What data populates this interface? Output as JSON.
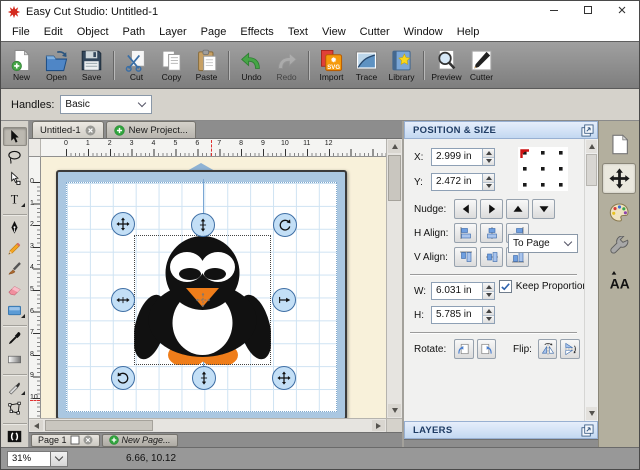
{
  "window": {
    "title": "Easy Cut Studio: Untitled-1",
    "app_icon": "app-logo",
    "controls": {
      "minimize_icon": "window-minimize",
      "maximize_icon": "window-maximize",
      "close_icon": "window-close"
    }
  },
  "menu": {
    "items": [
      "File",
      "Edit",
      "Object",
      "Path",
      "Layer",
      "Page",
      "Effects",
      "Text",
      "View",
      "Cutter",
      "Window",
      "Help"
    ]
  },
  "toolbar": {
    "buttons": [
      {
        "name": "new-button",
        "label": "New",
        "icon": "new-document"
      },
      {
        "name": "open-button",
        "label": "Open",
        "icon": "open-folder"
      },
      {
        "name": "save-button",
        "label": "Save",
        "icon": "save-floppy",
        "sep": true
      },
      {
        "name": "cut-button",
        "label": "Cut",
        "icon": "cut-scissors"
      },
      {
        "name": "copy-button",
        "label": "Copy",
        "icon": "copy-pages"
      },
      {
        "name": "paste-button",
        "label": "Paste",
        "icon": "paste-clipboard",
        "sep": true
      },
      {
        "name": "undo-button",
        "label": "Undo",
        "icon": "undo-arrow"
      },
      {
        "name": "redo-button",
        "label": "Redo",
        "icon": "redo-arrow",
        "disabled": true,
        "sep": true
      },
      {
        "name": "import-button",
        "label": "Import",
        "icon": "import-svg"
      },
      {
        "name": "trace-button",
        "label": "Trace",
        "icon": "trace-image"
      },
      {
        "name": "library-button",
        "label": "Library",
        "icon": "library-book",
        "sep": true
      },
      {
        "name": "preview-button",
        "label": "Preview",
        "icon": "preview-magnifier"
      },
      {
        "name": "cutter-button",
        "label": "Cutter",
        "icon": "cutter-blade"
      }
    ]
  },
  "handles_bar": {
    "label": "Handles:",
    "value": "Basic"
  },
  "document_tabs": {
    "untitled": {
      "label": "Untitled-1",
      "close_icon": "tab-close"
    },
    "new_project": {
      "label": "New Project...",
      "add_icon": "tab-add"
    }
  },
  "left_tools": [
    {
      "name": "select-tool",
      "icon": "select-arrow",
      "active": true
    },
    {
      "name": "lasso-tool",
      "icon": "lasso"
    },
    {
      "name": "node-edit-tool",
      "icon": "node-edit"
    },
    {
      "name": "text-tool",
      "icon": "text-t",
      "flyout": true
    },
    {
      "name": "pen-tool",
      "icon": "pen-nib"
    },
    {
      "name": "pencil-tool",
      "icon": "pencil"
    },
    {
      "name": "brush-tool",
      "icon": "brush"
    },
    {
      "name": "eraser-tool",
      "icon": "eraser"
    },
    {
      "name": "shape-tool",
      "icon": "rectangle-shape",
      "flyout": true
    },
    {
      "name": "eyedropper-tool",
      "icon": "eyedropper"
    },
    {
      "name": "gradient-tool",
      "icon": "gradient-fill"
    },
    {
      "name": "knife-tool",
      "icon": "knife",
      "flyout": true
    },
    {
      "name": "distort-tool",
      "icon": "distort-envelope"
    },
    {
      "name": "stencil-bridge-tool",
      "icon": "stencil-bridge"
    }
  ],
  "rulers": {
    "horizontal": [
      "0",
      "1",
      "2",
      "3",
      "4",
      "5",
      "6",
      "7",
      "8",
      "9",
      "10",
      "11",
      "12"
    ],
    "vertical": [
      "0",
      "1",
      "2",
      "3",
      "4",
      "5",
      "6",
      "7",
      "8",
      "9",
      "10"
    ],
    "cursor": {
      "x": "6.66",
      "y": "10.12"
    }
  },
  "canvas": {
    "object": "penguin-clipart",
    "colors": {
      "penguin_body": "#111111",
      "penguin_accent": "#ef7d1a",
      "mat_frame": "#aac7e1",
      "mat_grid": "#cfe3f3",
      "work_area": "#f8f1da"
    }
  },
  "selection": {
    "handles": {
      "top_left": "move-arrows",
      "top_center": "stretch-vertical",
      "top_right": "rotate-cw",
      "middle_left": "stretch-horizontal",
      "middle_right": "arrow-right-bar",
      "bottom_left": "rotate-ccw",
      "bottom_center": "stretch-vertical",
      "bottom_right": "move-arrows"
    },
    "center_icon": "crosshair-center"
  },
  "panels": {
    "position_size": {
      "title": "POSITION & SIZE",
      "popout_icon": "panel-popout",
      "x_label": "X:",
      "x_value": "2.999 in",
      "y_label": "Y:",
      "y_value": "2.472 in",
      "anchor_icon": "anchor-grid",
      "nudge": {
        "label": "Nudge:",
        "buttons": [
          {
            "name": "nudge-left-button",
            "icon": "nudge-left"
          },
          {
            "name": "nudge-right-button",
            "icon": "nudge-right"
          },
          {
            "name": "nudge-up-button",
            "icon": "nudge-up"
          },
          {
            "name": "nudge-down-button",
            "icon": "nudge-down"
          }
        ]
      },
      "h_align": {
        "label": "H Align:",
        "buttons": [
          {
            "name": "align-left-button",
            "icon": "align-left"
          },
          {
            "name": "align-center-button",
            "icon": "align-center-h"
          },
          {
            "name": "align-right-button",
            "icon": "align-right"
          }
        ]
      },
      "v_align": {
        "label": "V Align:",
        "buttons": [
          {
            "name": "align-top-button",
            "icon": "align-top"
          },
          {
            "name": "align-middle-button",
            "icon": "align-middle-v"
          },
          {
            "name": "align-bottom-button",
            "icon": "align-bottom"
          }
        ]
      },
      "align_scope": "To Page",
      "w_label": "W:",
      "w_value": "6.031 in",
      "h_label": "H:",
      "h_value": "5.785 in",
      "keep_proportions": {
        "label": "Keep Proportions",
        "checked": true,
        "check_icon": "checkmark"
      },
      "rotate": {
        "label": "Rotate:",
        "buttons": [
          {
            "name": "rotate-left-button",
            "icon": "rotate-page-left"
          },
          {
            "name": "rotate-right-button",
            "icon": "rotate-page-right"
          }
        ]
      },
      "flip": {
        "label": "Flip:",
        "buttons": [
          {
            "name": "flip-horizontal-button",
            "icon": "flip-horizontal"
          },
          {
            "name": "flip-vertical-button",
            "icon": "flip-vertical"
          }
        ]
      }
    },
    "layers": {
      "title": "LAYERS",
      "popout_icon": "panel-popout"
    }
  },
  "side_tabs": [
    {
      "name": "side-tab-document",
      "icon": "page-blank"
    },
    {
      "name": "side-tab-position",
      "icon": "move-cross",
      "active": true
    },
    {
      "name": "side-tab-colors",
      "icon": "palette"
    },
    {
      "name": "side-tab-settings",
      "icon": "wrench"
    },
    {
      "name": "side-tab-fonts",
      "icon": "fonts-aa"
    }
  ],
  "page_tabs": {
    "page1": {
      "label": "Page 1",
      "page_icon": "page-square",
      "close_icon": "tab-close"
    },
    "new_page": {
      "label": "New Page...",
      "add_icon": "tab-add"
    }
  },
  "status_bar": {
    "zoom_level": "31%",
    "cursor_position": "6.66, 10.12"
  }
}
